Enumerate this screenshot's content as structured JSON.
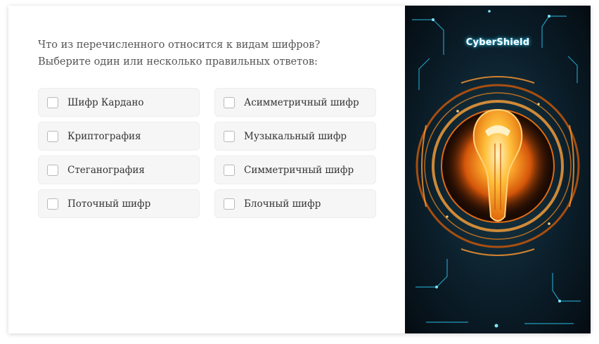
{
  "question": {
    "line1": "Что из перечисленного относится к видам шифров?",
    "line2": "Выберите один или несколько правильных ответов:"
  },
  "options": [
    {
      "label": "Шифр Кардано",
      "checked": false
    },
    {
      "label": "Асимметричный шифр",
      "checked": false
    },
    {
      "label": "Криптография",
      "checked": false
    },
    {
      "label": "Музыкальный шифр",
      "checked": false
    },
    {
      "label": "Стеганография",
      "checked": false
    },
    {
      "label": "Симметричный шифр",
      "checked": false
    },
    {
      "label": "Поточный шифр",
      "checked": false
    },
    {
      "label": "Блочный шифр",
      "checked": false
    }
  ],
  "illustration": {
    "brand": "CyberShield",
    "icon": "glowing-lightbulb-shield",
    "colors": {
      "background": "#071219",
      "glow_orange": "#ff8a1a",
      "glow_cyan": "#2ec7f0"
    }
  }
}
